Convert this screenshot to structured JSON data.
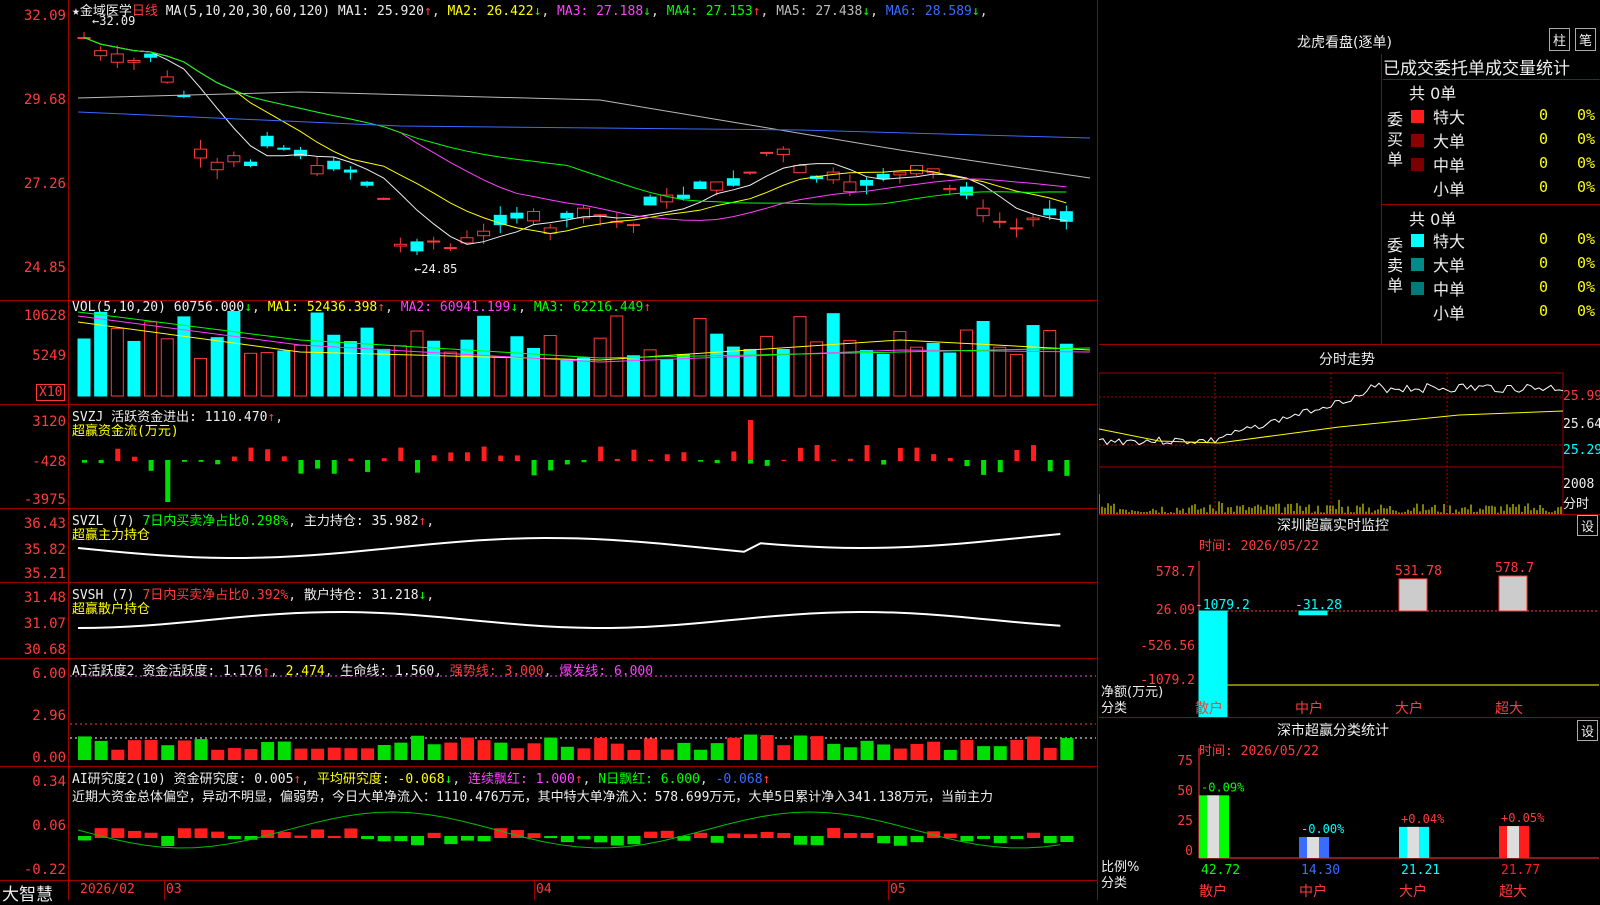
{
  "stock": {
    "name": "金域医学",
    "period": "日线",
    "star": "★"
  },
  "ma_legend": {
    "params": "MA(5,10,20,30,60,120)",
    "items": [
      {
        "label": "MA1: 25.920",
        "arrow": "↑",
        "color": "#eeeeee"
      },
      {
        "label": "MA2: 26.422",
        "arrow": "↓",
        "color": "#ffff00"
      },
      {
        "label": "MA3: 27.188",
        "arrow": "↓",
        "color": "#ff40ff"
      },
      {
        "label": "MA4: 27.153",
        "arrow": "↑",
        "color": "#00ff00"
      },
      {
        "label": "MA5: 27.438",
        "arrow": "↓",
        "color": "#bbbbbb"
      },
      {
        "label": "MA6: 28.589",
        "arrow": "↓",
        "color": "#3a6bff"
      }
    ]
  },
  "price_axis": [
    "32.09",
    "29.68",
    "27.26",
    "24.85"
  ],
  "price_marks": {
    "high": "32.09",
    "low": "24.85"
  },
  "vol": {
    "legend": "VOL(5,10,20)",
    "value": "60756.000",
    "arrow": "↓",
    "ma1": "MA1: 52436.398",
    "ma2": "MA2: 60941.199",
    "ma3": "MA3: 62216.449",
    "axis": [
      "10628",
      "5249"
    ],
    "unit": "X10"
  },
  "svzj": {
    "title": "SVZJ",
    "desc": "活跃资金进出: 1110.470",
    "sub": "超赢资金流(万元)",
    "axis": [
      "3120",
      "-428",
      "-3975"
    ]
  },
  "svzl": {
    "title": "SVZL (7)",
    "desc": "7日内买卖净占比0.298%",
    "hold": "主力持仓: 35.982",
    "sub": "超赢主力持仓",
    "axis": [
      "36.43",
      "35.82",
      "35.21"
    ]
  },
  "svsh": {
    "title": "SVSH (7)",
    "desc": "7日内买卖净占比0.392%",
    "hold": "散户持仓: 31.218",
    "sub": "超赢散户持仓",
    "axis": [
      "31.48",
      "31.07",
      "30.68"
    ]
  },
  "ai1": {
    "title": "AI活跃度2",
    "a": "资金活跃度: 1.176",
    "b": "2.474",
    "c": "生命线: 1.560",
    "d": "强势线: 3.000",
    "e": "爆发线: 6.000",
    "axis": [
      "6.00",
      "2.96",
      "0.00"
    ]
  },
  "ai2": {
    "title": "AI研究度2(10)",
    "a": "资金研究度: 0.005",
    "b": "平均研究度: -0.068",
    "c": "连续飘红: 1.000",
    "d": "N日飘红: 6.000",
    "e": "-0.068",
    "axis": [
      "0.34",
      "0.06",
      "-0.22"
    ],
    "comment": "近期大资金总体偏空，异动不明显，偏弱势，今日大单净流入：1110.476万元，其中特大单净流入：578.699万元，大单5日累计净入341.138万元，当前主力"
  },
  "footer": {
    "brand": "大智慧",
    "dates": [
      "2026/02",
      "03",
      "04",
      "05"
    ]
  },
  "longhu": {
    "title": "龙虎看盘(逐单)",
    "btn1": "柱",
    "btn2": "笔",
    "header": "已成交委托单成交量统计",
    "buy": {
      "label": "委买单",
      "total": "共 0单",
      "rows": [
        {
          "name": "特大",
          "v": "0",
          "p": "0%"
        },
        {
          "name": "大单",
          "v": "0",
          "p": "0%"
        },
        {
          "name": "中单",
          "v": "0",
          "p": "0%"
        },
        {
          "name": "小单",
          "v": "0",
          "p": "0%"
        }
      ]
    },
    "sell": {
      "label": "委卖单",
      "total": "共 0单",
      "rows": [
        {
          "name": "特大",
          "v": "0",
          "p": "0%"
        },
        {
          "name": "大单",
          "v": "0",
          "p": "0%"
        },
        {
          "name": "中单",
          "v": "0",
          "p": "0%"
        },
        {
          "name": "小单",
          "v": "0",
          "p": "0%"
        }
      ]
    }
  },
  "fenshi": {
    "title": "分时走势",
    "axis": [
      "25.99",
      "25.64",
      "25.29"
    ],
    "vol_axis": [
      "2008",
      "分时"
    ]
  },
  "sz_monitor": {
    "title": "深圳超赢实时监控",
    "btn": "设",
    "time": "时间: 2026/05/22",
    "axis": [
      "578.7",
      "26.09",
      "-526.56",
      "-1079.2"
    ],
    "unit1": "净额(万元)",
    "unit2": "分类",
    "bars": [
      {
        "cat": "散户",
        "val": "-1079.2"
      },
      {
        "cat": "中户",
        "val": "-31.28"
      },
      {
        "cat": "大户",
        "val": "531.78"
      },
      {
        "cat": "超大",
        "val": "578.7"
      }
    ]
  },
  "sz_class": {
    "title": "深市超赢分类统计",
    "btn": "设",
    "time": "时间: 2026/05/22",
    "axis": [
      "75",
      "50",
      "25",
      "0"
    ],
    "unit1": "比例%",
    "unit2": "分类",
    "bars": [
      {
        "cat": "散户",
        "top": "-0.09%",
        "val": "42.72"
      },
      {
        "cat": "中户",
        "top": "-0.00%",
        "val": "14.30"
      },
      {
        "cat": "大户",
        "top": "+0.04%",
        "val": "21.21"
      },
      {
        "cat": "超大",
        "top": "+0.05%",
        "val": "21.77"
      }
    ]
  }
}
